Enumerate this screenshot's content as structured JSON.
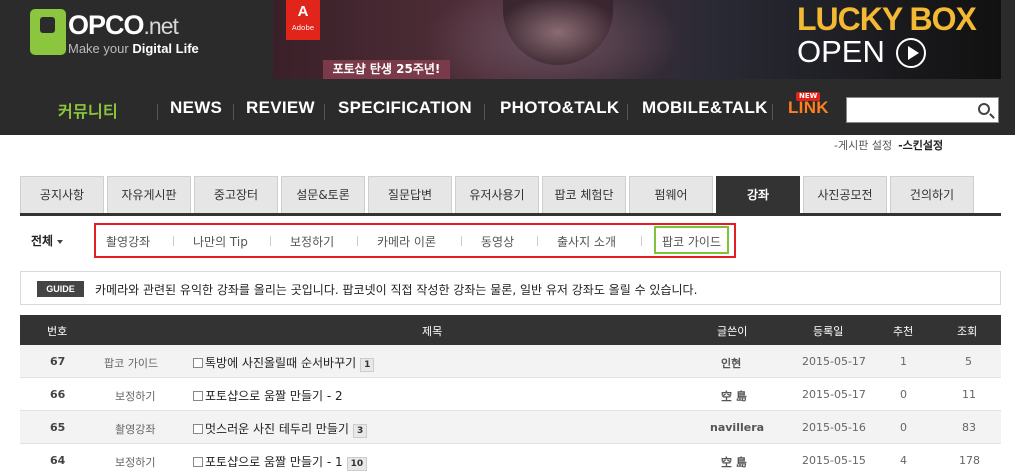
{
  "brand": {
    "logo_text": "OPCO",
    "logo_net": ".net",
    "tagline_pre": "Make your ",
    "tagline_bold": "Digital Life"
  },
  "banner": {
    "adobe_letter": "A",
    "adobe_label": "Adobe",
    "caption": "포토샵 탄생 25주년!",
    "promo_line1": "LUCKY BOX",
    "promo_line2": "OPEN"
  },
  "nav": {
    "items": [
      "커뮤니티",
      "NEWS",
      "REVIEW",
      "SPECIFICATION",
      "PHOTO&TALK",
      "MOBILE&TALK",
      "LINK"
    ],
    "new_badge": "NEW",
    "search_placeholder": "",
    "colors": {
      "active": "#8cc63f",
      "link": "#ff7f1e"
    }
  },
  "settings": {
    "board_settings": "-게시판 설정",
    "skin_settings": "-스킨설정"
  },
  "tabs": {
    "items": [
      "공지사항",
      "자유게시판",
      "중고장터",
      "설문&토론",
      "질문답변",
      "유저사용기",
      "팝코 체험단",
      "펌웨어",
      "강좌",
      "사진공모전",
      "건의하기"
    ],
    "active": "강좌"
  },
  "subnav": {
    "all_label": "전체",
    "items": [
      "촬영강좌",
      "나만의 Tip",
      "보정하기",
      "카메라 이론",
      "동영상",
      "출사지 소개",
      "팝코 가이드"
    ],
    "highlighted": "팝코 가이드"
  },
  "guide": {
    "badge": "GUIDE",
    "text": "카메라와 관련된 유익한 강좌를 올리는 곳입니다. 팝코넷이 직접 작성한 강좌는 물론, 일반 유저 강좌도 올릴 수 있습니다."
  },
  "table": {
    "headers": {
      "num": "번호",
      "title": "제목",
      "author": "글쓴이",
      "date": "등록일",
      "recommend": "추천",
      "views": "조회"
    },
    "rows": [
      {
        "num": "67",
        "category": "팝코 가이드",
        "title": "톡방에 사진올릴때 순서바꾸기",
        "comments": "1",
        "author": "인현",
        "date": "2015-05-17",
        "recommend": "1",
        "views": "5"
      },
      {
        "num": "66",
        "category": "보정하기",
        "title": "포토샵으로 움짤 만들기 - 2",
        "comments": "",
        "author": "空 島",
        "date": "2015-05-17",
        "recommend": "0",
        "views": "11"
      },
      {
        "num": "65",
        "category": "촬영강좌",
        "title": "멋스러운 사진 테두리 만들기",
        "comments": "3",
        "author": "navillera",
        "date": "2015-05-16",
        "recommend": "0",
        "views": "83"
      },
      {
        "num": "64",
        "category": "보정하기",
        "title": "포토샵으로 움짤 만들기 - 1",
        "comments": "10",
        "author": "空 島",
        "date": "2015-05-15",
        "recommend": "4",
        "views": "178"
      }
    ]
  }
}
